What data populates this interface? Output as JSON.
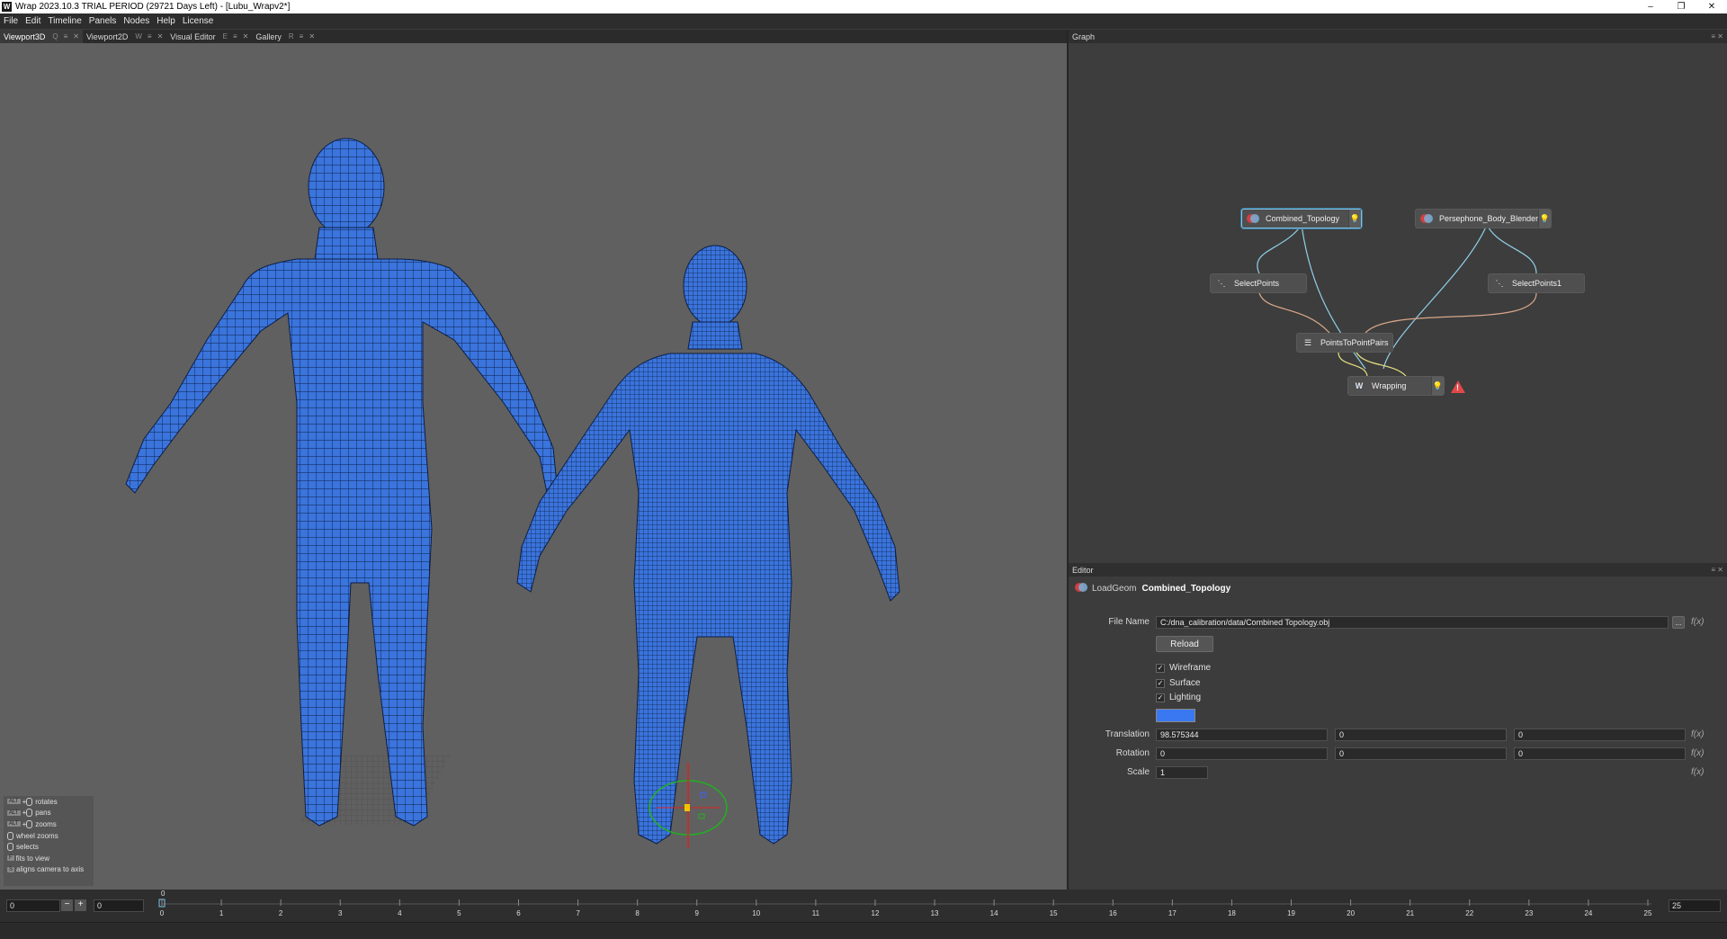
{
  "window": {
    "title": "Wrap 2023.10.3  TRIAL PERIOD (29721 Days Left) - [Lubu_Wrapv2*]",
    "icon": "W",
    "controls": {
      "minimize": "–",
      "maximize": "❐",
      "close": "✕"
    }
  },
  "menu": [
    "File",
    "Edit",
    "Timeline",
    "Panels",
    "Nodes",
    "Help",
    "License"
  ],
  "left_tabs": [
    {
      "label": "Viewport3D",
      "shortcut": "Q",
      "active": true
    },
    {
      "label": "Viewport2D",
      "shortcut": "W",
      "active": false
    },
    {
      "label": "Visual Editor",
      "shortcut": "E",
      "active": false
    },
    {
      "label": "Gallery",
      "shortcut": "R",
      "active": false
    }
  ],
  "viewport": {
    "background": "#606060",
    "mesh_color": "#3a74dc",
    "help": [
      {
        "keys": "ALT + ⬤",
        "text": "rotates"
      },
      {
        "keys": "ALT + ⬤",
        "text": "pans"
      },
      {
        "keys": "ALT + ⬤",
        "text": "zooms"
      },
      {
        "keys": "⬤",
        "text": "wheel zooms"
      },
      {
        "keys": "⬤",
        "text": "selects"
      },
      {
        "keys": "F",
        "text": "fits to view"
      },
      {
        "keys": "S",
        "text": "aligns camera to axis"
      }
    ]
  },
  "graph": {
    "title": "Graph",
    "nodes": [
      {
        "id": "combined",
        "label": "Combined_Topology",
        "icon": "loadgeom-icon",
        "selected": true
      },
      {
        "id": "persephone",
        "label": "Persephone_Body_Blender",
        "icon": "loadgeom-icon",
        "selected": false
      },
      {
        "id": "select1",
        "label": "SelectPoints",
        "icon": "select-points-icon",
        "selected": false
      },
      {
        "id": "select2",
        "label": "SelectPoints1",
        "icon": "select-points-icon",
        "selected": false
      },
      {
        "id": "pairs",
        "label": "PointsToPointPairs",
        "icon": "point-pairs-icon",
        "selected": false
      },
      {
        "id": "wrapping",
        "label": "Wrapping",
        "icon": "wrap-icon",
        "selected": false,
        "warning": true
      }
    ],
    "wire_colors": {
      "geometry": "#8fd0e8",
      "points": "#d9a88a"
    }
  },
  "editor": {
    "title": "Editor",
    "node_type": "LoadGeom",
    "node_name": "Combined_Topology",
    "file_name_label": "File Name",
    "file_name": "C:/dna_calibration/data/Combined Topology.obj",
    "browse_label": "...",
    "reload_label": "Reload",
    "checkboxes": [
      {
        "label": "Wireframe",
        "checked": true
      },
      {
        "label": "Surface",
        "checked": true
      },
      {
        "label": "Lighting",
        "checked": true
      }
    ],
    "color": "#3a78f2",
    "translation_label": "Translation",
    "translation": [
      "98.575344",
      "0",
      "0"
    ],
    "rotation_label": "Rotation",
    "rotation": [
      "0",
      "0",
      "0"
    ],
    "scale_label": "Scale",
    "scale": "1",
    "fx_label": "f(x)"
  },
  "timeline": {
    "current_frame": "0",
    "start_field": "0",
    "end_field": "0",
    "end_frame": "25",
    "minus": "−",
    "plus": "+",
    "ticks": [
      "0",
      "1",
      "2",
      "3",
      "4",
      "5",
      "6",
      "7",
      "8",
      "9",
      "10",
      "11",
      "12",
      "13",
      "14",
      "15",
      "16",
      "17",
      "18",
      "19",
      "20",
      "21",
      "22",
      "23",
      "24",
      "25"
    ]
  }
}
